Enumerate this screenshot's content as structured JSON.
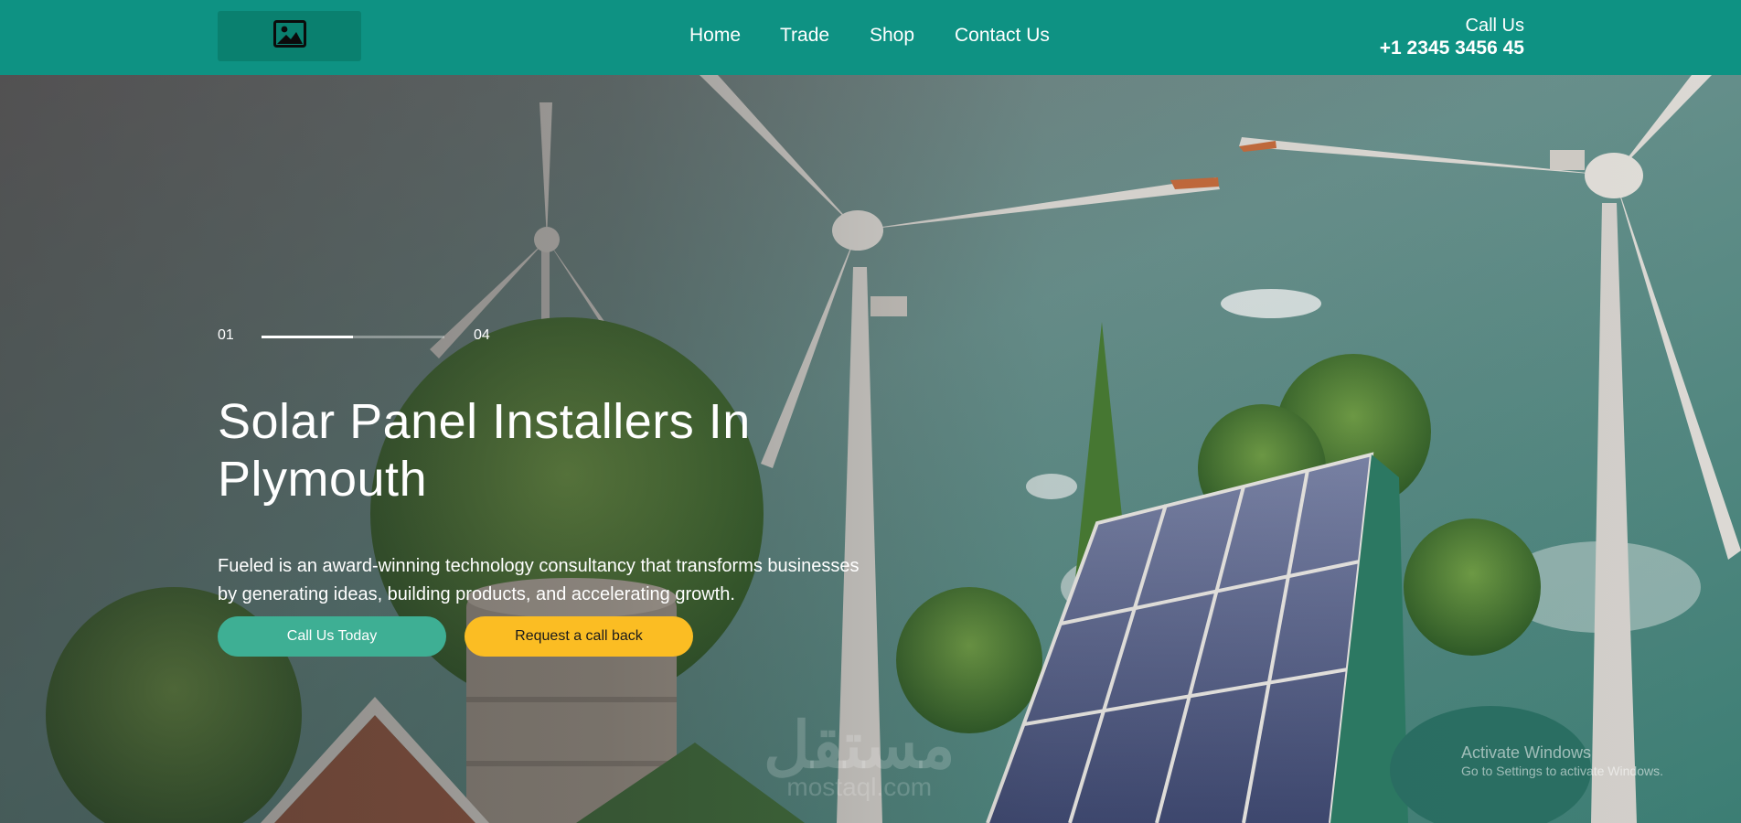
{
  "colors": {
    "header_bg": "#0e9283",
    "logo_bg": "#0a806f",
    "primary_button": "#3eaf94",
    "secondary_button": "#fbbd23"
  },
  "header": {
    "logo_icon": "image-icon",
    "nav": {
      "home": "Home",
      "trade": "Trade",
      "shop": "Shop",
      "contact": "Contact Us"
    },
    "call_label": "Call Us",
    "call_number": "+1 2345 3456 45"
  },
  "hero": {
    "slide_current": "01",
    "slide_total": "04",
    "slide_progress": 0.5,
    "title": "Solar Panel Installers In Plymouth",
    "description": "Fueled is an award-winning technology consultancy that transforms businesses by generating ideas, building products, and accelerating growth.",
    "primary_button": "Call Us Today",
    "secondary_button": "Request a call back"
  },
  "watermark": {
    "arabic": "مستقل",
    "latin": "mostaql.com"
  },
  "system_overlay": {
    "title": "Activate Windows",
    "subtitle": "Go to Settings to activate Windows."
  }
}
